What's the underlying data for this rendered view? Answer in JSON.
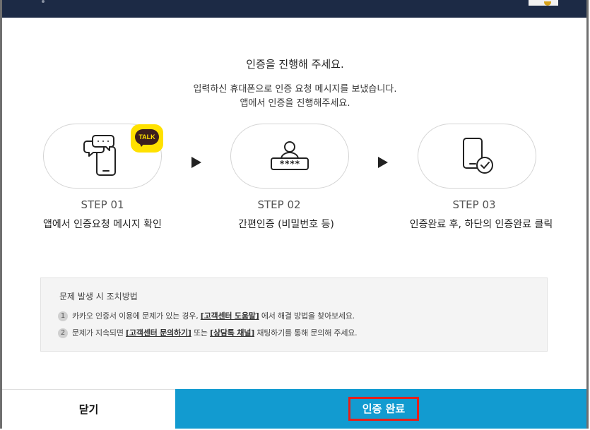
{
  "dialog": {
    "title": "인증을 진행해 주세요.",
    "desc_line1": "입력하신 휴대폰으로 인증 요청 메시지를 보냈습니다.",
    "desc_line2": "앱에서 인증을 진행해주세요."
  },
  "badge": {
    "label": "TALK",
    "color": "#ffe100"
  },
  "steps": [
    {
      "label": "STEP 01",
      "desc": "앱에서 인증요청 메시지 확인",
      "icon": "phone-message-icon"
    },
    {
      "label": "STEP 02",
      "desc": "간편인증 (비밀번호 등)",
      "icon": "user-password-icon"
    },
    {
      "label": "STEP 03",
      "desc": "인증완료 후, 하단의 인증완료 클릭",
      "icon": "phone-check-icon"
    }
  ],
  "help": {
    "title": "문제 발생 시 조치방법",
    "items": [
      {
        "num": "1",
        "before": "카카오 인증서 이용에 문제가 있는 경우, ",
        "link": "[고객센터 도움말]",
        "after": " 에서 해결 방법을 찾아보세요."
      },
      {
        "num": "2",
        "before": "문제가 지속되면 ",
        "link1": "[고객센터 문의하기]",
        "mid": " 또는 ",
        "link2": "[상담톡 채널]",
        "after": " 채팅하기를 통해 문의해 주세요."
      }
    ]
  },
  "buttons": {
    "close": "닫기",
    "done": "인증 완료"
  },
  "colors": {
    "primary": "#129bd0",
    "highlight": "#e3201b",
    "header": "#1c2a45"
  }
}
